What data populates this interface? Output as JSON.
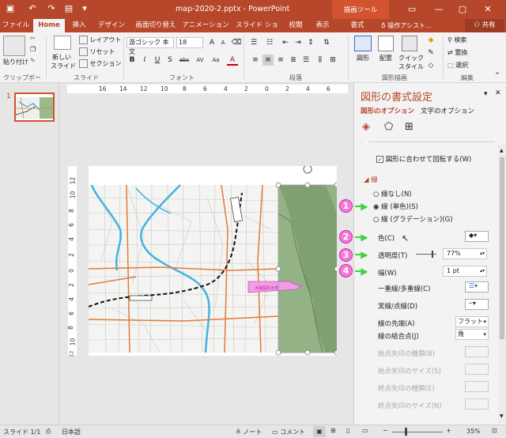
{
  "window": {
    "title": "map-2020-2.pptx - PowerPoint",
    "context_tab_group": "描画ツール",
    "signin_icon": "ribbon-display-options-icon",
    "controls": [
      "minimize-icon",
      "maximize-icon",
      "close-icon"
    ]
  },
  "tabs": [
    {
      "label": "ファイル"
    },
    {
      "label": "Home"
    },
    {
      "label": "挿入"
    },
    {
      "label": "デザイン"
    },
    {
      "label": "画面切り替え"
    },
    {
      "label": "アニメーション"
    },
    {
      "label": "スライド ショー"
    },
    {
      "label": "校閲"
    },
    {
      "label": "表示"
    },
    {
      "label": "書式"
    }
  ],
  "tell_me": "操作アシスト...",
  "share": "共有",
  "ribbon": {
    "clipboard": {
      "paste": "貼り付け",
      "label": "クリップボード"
    },
    "slides": {
      "new_slide_1": "新しい",
      "new_slide_2": "スライド",
      "layout": "レイアウト",
      "reset": "リセット",
      "section": "セクション",
      "label": "スライド"
    },
    "font": {
      "font_name": "游ゴシック 本文",
      "font_size": "18",
      "label": "フォント",
      "bold": "B",
      "italic": "I",
      "underline": "U",
      "shadow": "S",
      "strike": "abc",
      "spacing": "AV",
      "case": "Aa"
    },
    "paragraph": {
      "label": "段落"
    },
    "drawing": {
      "shapes": "図形",
      "arrange": "配置",
      "quick_style_1": "クイック",
      "quick_style_2": "スタイル",
      "label": "図形描画"
    },
    "editing": {
      "find": "検索",
      "replace": "置換",
      "select": "選択",
      "label": "編集"
    }
  },
  "thumbnail": {
    "number": "1"
  },
  "ruler": {
    "horizontal": [
      "16",
      "14",
      "12",
      "10",
      "8",
      "6",
      "4",
      "2",
      "0",
      "2",
      "4",
      "6"
    ],
    "vertical": [
      "12",
      "10",
      "8",
      "6",
      "4",
      "2",
      "0",
      "2",
      "4",
      "6",
      "8",
      "10",
      "12"
    ]
  },
  "map": {
    "label": "大阪医科大学"
  },
  "pane": {
    "title": "図形の書式設定",
    "tab_shape": "図形のオプション",
    "tab_text": "文字のオプション",
    "rotate_with_shape": "図形に合わせて回転する(W)",
    "line_section": "線",
    "no_line": "線なし(N)",
    "solid_line": "線 (単色)(S)",
    "gradient_line": "線 (グラデーション)(G)",
    "color": "色(C)",
    "transparency": "透明度(T)",
    "transparency_value": "77%",
    "width": "幅(W)",
    "width_value": "1 pt",
    "compound": "一重線/多重線(C)",
    "dash": "実線/点線(D)",
    "cap": "線の先端(A)",
    "cap_value": "フラット",
    "join": "線の結合点(J)",
    "join_value": "角",
    "begin_arrow_type": "始点矢印の種類(B)",
    "begin_arrow_size": "始点矢印のサイズ(S)",
    "end_arrow_type": "終点矢印の種類(E)",
    "end_arrow_size": "終点矢印のサイズ(N)",
    "callouts": [
      "1",
      "2",
      "3",
      "4"
    ]
  },
  "status": {
    "slide": "スライド 1/1",
    "language": "日本語",
    "notes": "ノート",
    "comments": "コメント",
    "zoom": "35%"
  },
  "colors": {
    "accent": "#b7472a",
    "callout": "#f37bd7",
    "arrow": "#3bd33b"
  }
}
